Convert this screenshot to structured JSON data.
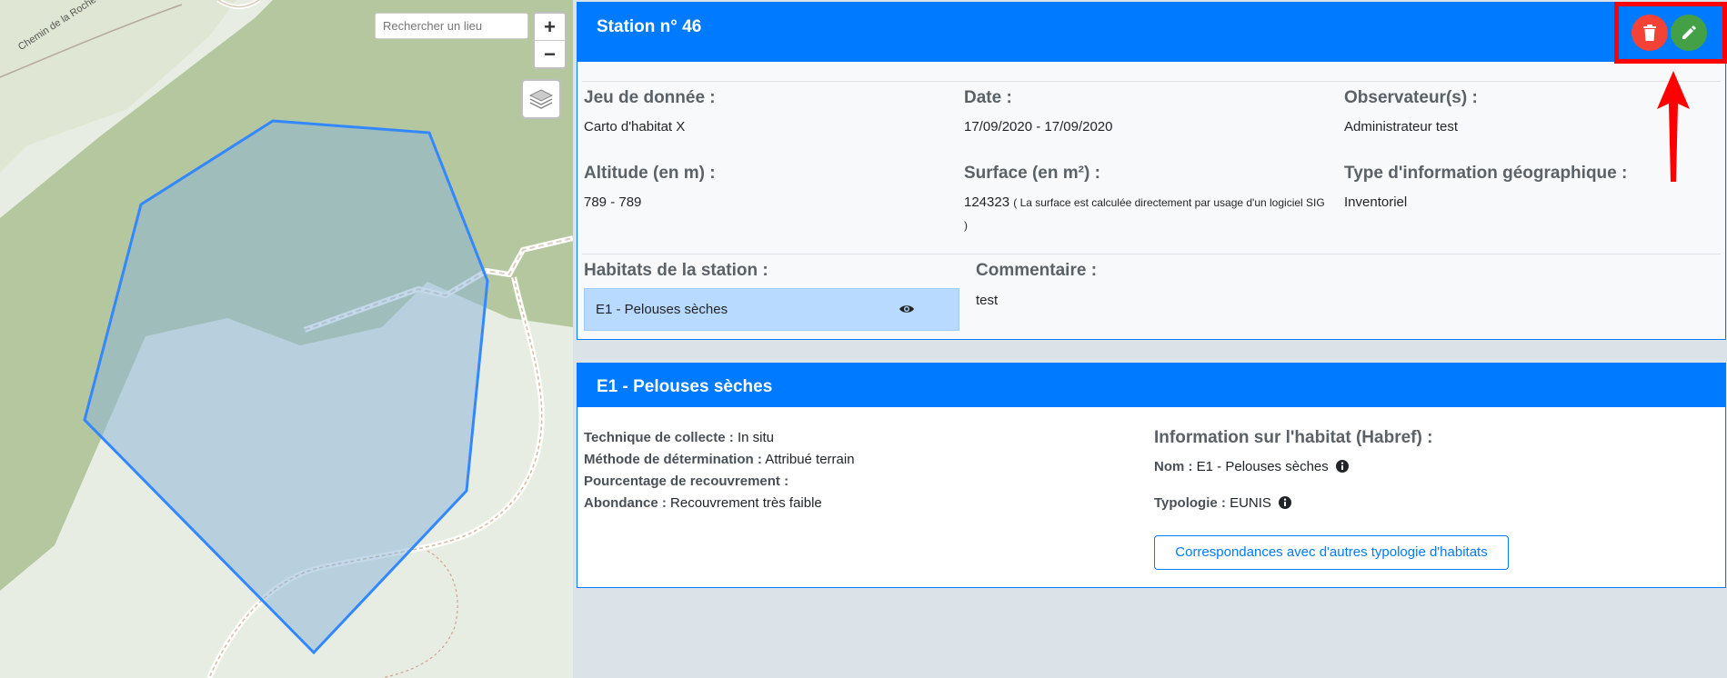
{
  "map": {
    "road_label": "Chemin de la Roche",
    "search_placeholder": "Rechercher un lieu",
    "zoom_in": "+",
    "zoom_out": "−",
    "layers_icon": "layers-icon"
  },
  "station": {
    "title": "Station n° 46",
    "actions": {
      "delete_icon": "trash-icon",
      "edit_icon": "pencil-icon",
      "delete_color": "#f44336",
      "edit_color": "#43a047"
    },
    "dataset_label": "Jeu de donnée :",
    "dataset_value": "Carto d'habitat X",
    "date_label": "Date :",
    "date_value": "17/09/2020 - 17/09/2020",
    "observers_label": "Observateur(s) :",
    "observers_value": "Administrateur test",
    "altitude_label": "Altitude (en m) :",
    "altitude_value": "789 - 789",
    "surface_label": "Surface (en m²) :",
    "surface_value": "124323",
    "surface_note": "( La surface est calculée directement par usage d'un logiciel SIG",
    "surface_note_end": ")",
    "geo_type_label": "Type d'information géographique :",
    "geo_type_value": "Inventoriel",
    "habitats_label": "Habitats de la station :",
    "habitat_item": "E1 - Pelouses sèches",
    "comment_label": "Commentaire :",
    "comment_value": "test"
  },
  "habitat": {
    "title": "E1 - Pelouses sèches",
    "technique_label": "Technique de collecte :",
    "technique_value": "In situ",
    "method_label": "Méthode de détermination :",
    "method_value": "Attribué terrain",
    "coverage_label": "Pourcentage de recouvrement :",
    "coverage_value": "",
    "abundance_label": "Abondance :",
    "abundance_value": "Recouvrement très faible",
    "info_title": "Information sur l'habitat (Habref) :",
    "name_label": "Nom :",
    "name_value": "E1 - Pelouses sèches",
    "typology_label": "Typologie :",
    "typology_value": "EUNIS",
    "correspondence_button": "Correspondances avec d'autres typologie d'habitats"
  },
  "colors": {
    "primary": "#007bff",
    "highlight": "#ff0000",
    "selected_row": "#b8daff"
  }
}
